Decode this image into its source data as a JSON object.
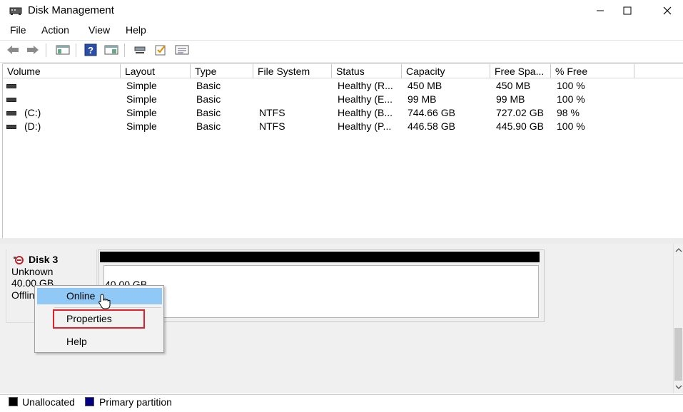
{
  "window": {
    "title": "Disk Management"
  },
  "menu": [
    "File",
    "Action",
    "View",
    "Help"
  ],
  "toolbar_icons": [
    "back-arrow-icon",
    "forward-arrow-icon",
    "console-tree-icon",
    "help-icon",
    "show-hide-icon",
    "connect-icon",
    "check-icon",
    "properties-icon"
  ],
  "columns": [
    "Volume",
    "Layout",
    "Type",
    "File System",
    "Status",
    "Capacity",
    "Free Spa...",
    "% Free"
  ],
  "volumes": [
    {
      "volume": "",
      "layout": "Simple",
      "type": "Basic",
      "fs": "",
      "status": "Healthy (R...",
      "capacity": "450 MB",
      "free": "450 MB",
      "pct": "100 %"
    },
    {
      "volume": "",
      "layout": "Simple",
      "type": "Basic",
      "fs": "",
      "status": "Healthy (E...",
      "capacity": "99 MB",
      "free": "99 MB",
      "pct": "100 %"
    },
    {
      "volume": "(C:)",
      "layout": "Simple",
      "type": "Basic",
      "fs": "NTFS",
      "status": "Healthy (B...",
      "capacity": "744.66 GB",
      "free": "727.02 GB",
      "pct": "98 %"
    },
    {
      "volume": "(D:)",
      "layout": "Simple",
      "type": "Basic",
      "fs": "NTFS",
      "status": "Healthy (P...",
      "capacity": "446.58 GB",
      "free": "445.90 GB",
      "pct": "100 %"
    }
  ],
  "disk": {
    "name": "Disk 3",
    "type": "Unknown",
    "size": "40.00 GB",
    "state": "Offlin",
    "partition_size": "40.00 GB"
  },
  "context_menu": {
    "online": "Online",
    "properties": "Properties",
    "help": "Help"
  },
  "legend": {
    "unallocated": "Unallocated",
    "primary": "Primary partition",
    "unallocated_color": "#000000",
    "primary_color": "#000080"
  }
}
